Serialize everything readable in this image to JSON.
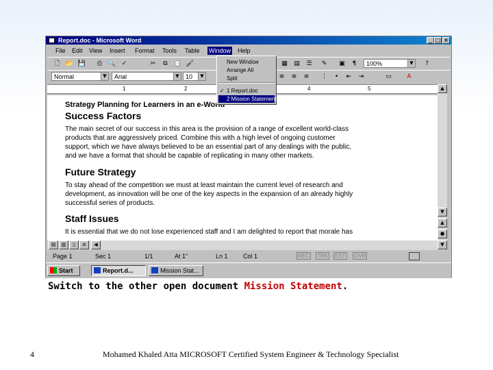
{
  "window": {
    "title": "Report.doc - Microsoft Word",
    "menu": [
      "File",
      "Edit",
      "View",
      "Insert",
      "Format",
      "Tools",
      "Table",
      "Window",
      "Help"
    ],
    "active_menu": "Window"
  },
  "window_menu": {
    "items": [
      "New Window",
      "Arrange All",
      "Split"
    ],
    "documents": [
      "1 Report.doc",
      "2 Mission Statement.doc"
    ],
    "checked": "1 Report.doc",
    "highlighted": "2 Mission Statement.doc"
  },
  "toolbar": {
    "zoom": "100%",
    "style": "Normal",
    "font": "Arial",
    "size": "10"
  },
  "ruler": [
    "1",
    "2",
    "4",
    "5"
  ],
  "document": {
    "lines": [
      {
        "text": "Strategy Planning for Learners in an e-World",
        "style": "h2"
      },
      {
        "text": "Success Factors",
        "style": "h1"
      },
      {
        "text": "The main secret of our success in this area is the provision of a range of excellent world-class",
        "style": "p"
      },
      {
        "text": "products that are aggressively priced. Combine this with a high level of ongoing customer",
        "style": "p"
      },
      {
        "text": "support, which we have always believed to be an essential part of any dealings with the public,",
        "style": "p"
      },
      {
        "text": "and we have a format that should be capable of replicating in many other markets.",
        "style": "p"
      },
      {
        "text": "Future Strategy",
        "style": "h1"
      },
      {
        "text": "To stay ahead of the competition we must at least maintain the current level of research and",
        "style": "p"
      },
      {
        "text": "development, as innovation will be one of the key aspects in the expansion of an already highly",
        "style": "p"
      },
      {
        "text": "successful series of products.",
        "style": "p"
      },
      {
        "text": "Staff Issues",
        "style": "h1"
      },
      {
        "text": "It is essential that we do not lose experienced staff and I am delighted to report that morale has",
        "style": "p"
      }
    ]
  },
  "status": {
    "page": "Page 1",
    "sec": "Sec 1",
    "pages": "1/1",
    "at": "At 1\"",
    "ln": "Ln 1",
    "col": "Col 1",
    "modes": [
      "REC",
      "TRK",
      "EXT",
      "OVR"
    ]
  },
  "taskbar": {
    "start": "Start",
    "tasks": [
      "Report.d...",
      "Mission Stat..."
    ]
  },
  "caption": {
    "prefix": "Switch to the other open document ",
    "highlight": "Mission Statement",
    "suffix": "."
  },
  "footer": {
    "page_number": "4",
    "text": "Mohamed Khaled Atta MICROSOFT Certified System Engineer & Technology Specialist"
  },
  "colors": {
    "titlebar": "#000080",
    "highlight": "#c00000",
    "menu_highlight": "#000080"
  }
}
